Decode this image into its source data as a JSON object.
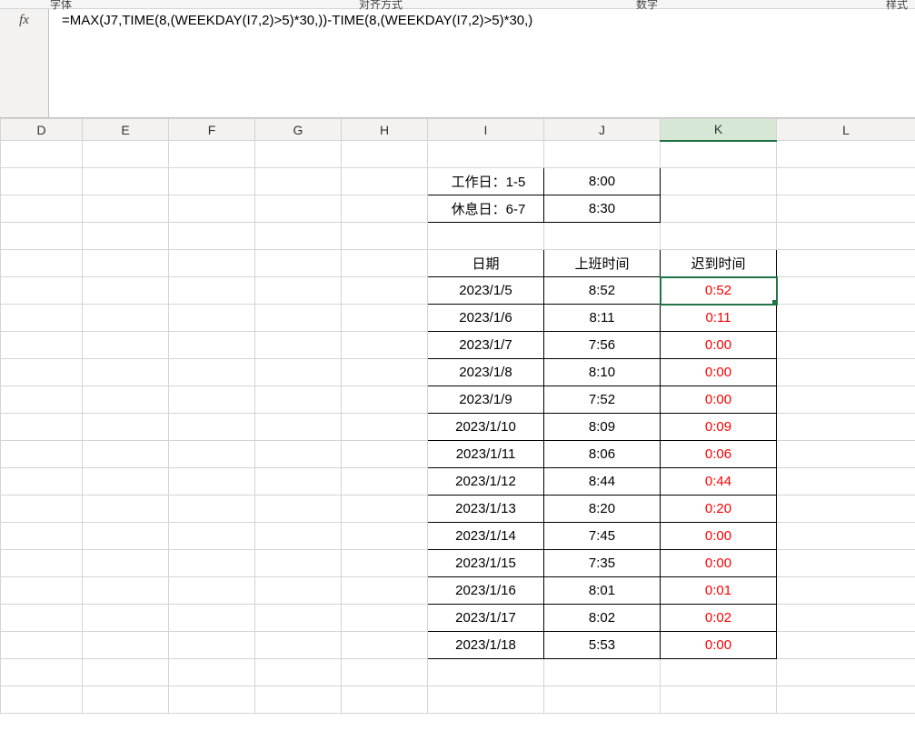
{
  "ribbon": {
    "group1": "字体",
    "group2": "对齐方式",
    "group3": "数字",
    "group4": "样式"
  },
  "formula_bar": {
    "fx": "fx",
    "formula": "=MAX(J7,TIME(8,(WEEKDAY(I7,2)>5)*30,))-TIME(8,(WEEKDAY(I7,2)>5)*30,)"
  },
  "columns": {
    "D": "D",
    "E": "E",
    "F": "F",
    "G": "G",
    "H": "H",
    "I": "I",
    "J": "J",
    "K": "K",
    "L": "L"
  },
  "rules": {
    "r1_label": "工作日：1-5",
    "r1_time": "8:00",
    "r2_label": "休息日：6-7",
    "r2_time": "8:30"
  },
  "table": {
    "h_date": "日期",
    "h_time": "上班时间",
    "h_late": "迟到时间",
    "rows": [
      {
        "date": "2023/1/5",
        "time": "8:52",
        "late": "0:52"
      },
      {
        "date": "2023/1/6",
        "time": "8:11",
        "late": "0:11"
      },
      {
        "date": "2023/1/7",
        "time": "7:56",
        "late": "0:00"
      },
      {
        "date": "2023/1/8",
        "time": "8:10",
        "late": "0:00"
      },
      {
        "date": "2023/1/9",
        "time": "7:52",
        "late": "0:00"
      },
      {
        "date": "2023/1/10",
        "time": "8:09",
        "late": "0:09"
      },
      {
        "date": "2023/1/11",
        "time": "8:06",
        "late": "0:06"
      },
      {
        "date": "2023/1/12",
        "time": "8:44",
        "late": "0:44"
      },
      {
        "date": "2023/1/13",
        "time": "8:20",
        "late": "0:20"
      },
      {
        "date": "2023/1/14",
        "time": "7:45",
        "late": "0:00"
      },
      {
        "date": "2023/1/15",
        "time": "7:35",
        "late": "0:00"
      },
      {
        "date": "2023/1/16",
        "time": "8:01",
        "late": "0:01"
      },
      {
        "date": "2023/1/17",
        "time": "8:02",
        "late": "0:02"
      },
      {
        "date": "2023/1/18",
        "time": "5:53",
        "late": "0:00"
      }
    ]
  }
}
